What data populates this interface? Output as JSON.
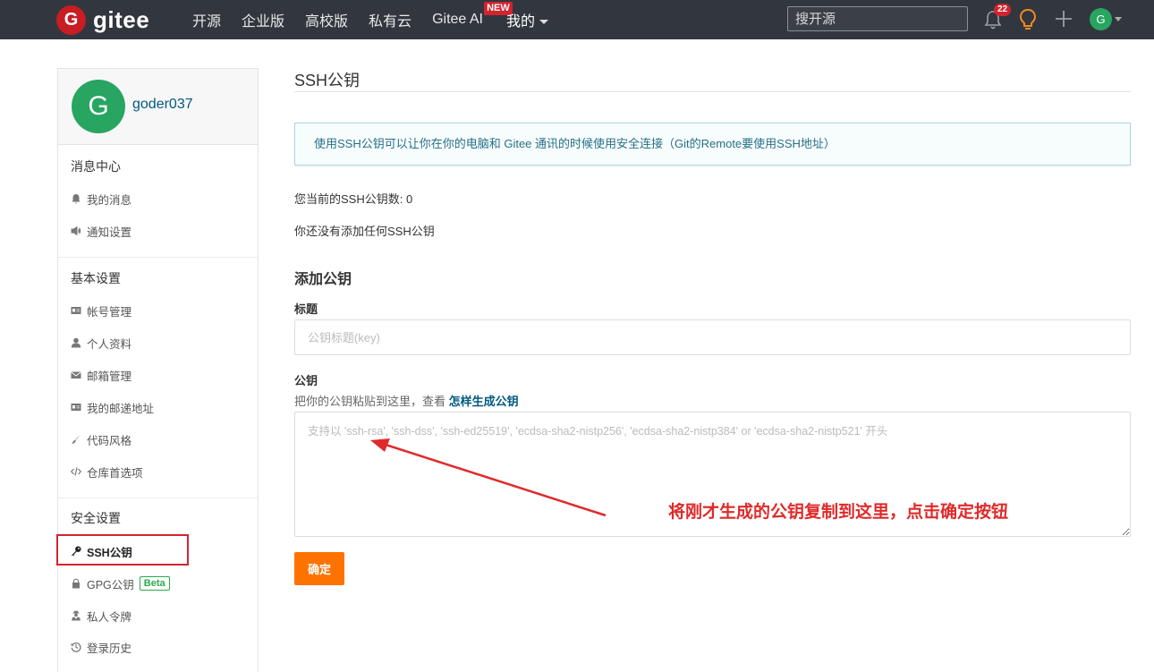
{
  "topbar": {
    "logo_letter": "G",
    "logo_text": "gitee",
    "nav": [
      {
        "label": "开源"
      },
      {
        "label": "企业版"
      },
      {
        "label": "高校版"
      },
      {
        "label": "私有云"
      },
      {
        "label": "Gitee AI",
        "badge": "NEW"
      },
      {
        "label": "我的"
      }
    ],
    "search_placeholder": "搜开源",
    "notification_count": "22",
    "avatar_letter": "G",
    "icons": [
      "bell-icon",
      "lightbulb-icon",
      "plus-icon",
      "chevron-down-icon"
    ]
  },
  "sidebar": {
    "profile": {
      "avatar_letter": "G",
      "username": "goder037"
    },
    "sections": [
      {
        "title": "消息中心",
        "items": [
          {
            "label": "我的消息",
            "icon": "bell-icon"
          },
          {
            "label": "通知设置",
            "icon": "volume-icon"
          }
        ]
      },
      {
        "title": "基本设置",
        "items": [
          {
            "label": "帐号管理",
            "icon": "id-card-icon"
          },
          {
            "label": "个人资料",
            "icon": "user-icon"
          },
          {
            "label": "邮箱管理",
            "icon": "envelope-icon"
          },
          {
            "label": "我的邮递地址",
            "icon": "id-card-icon"
          },
          {
            "label": "代码风格",
            "icon": "brush-icon"
          },
          {
            "label": "仓库首选项",
            "icon": "code-icon"
          }
        ]
      },
      {
        "title": "安全设置",
        "items": [
          {
            "label": "SSH公钥",
            "icon": "key-icon",
            "active": true
          },
          {
            "label": "GPG公钥",
            "icon": "lock-icon",
            "badge": "Beta"
          },
          {
            "label": "私人令牌",
            "icon": "user-secret-icon"
          },
          {
            "label": "登录历史",
            "icon": "history-icon"
          }
        ]
      }
    ]
  },
  "main": {
    "title": "SSH公钥",
    "info": "使用SSH公钥可以让你在你的电脑和 Gitee 通讯的时候使用安全连接（Git的Remote要使用SSH地址）",
    "count_text": "您当前的SSH公钥数: 0",
    "empty_text": "你还没有添加任何SSH公钥",
    "add_heading": "添加公钥",
    "title_label": "标题",
    "title_placeholder": "公钥标题(key)",
    "key_label": "公钥",
    "key_hint": "把你的公钥粘贴到这里，查看 ",
    "key_hint_link": "怎样生成公钥",
    "key_placeholder": "支持以 'ssh-rsa', 'ssh-dss', 'ssh-ed25519', 'ecdsa-sha2-nistp256', 'ecdsa-sha2-nistp384' or 'ecdsa-sha2-nistp521' 开头",
    "confirm_label": "确定"
  },
  "annotation": {
    "text": "将刚才生成的公钥复制到这里，点击确定按钮",
    "color": "#e02a2a"
  },
  "colors": {
    "topbar_bg": "#32363f",
    "brand_red": "#c71d23",
    "confirm_orange": "#fe7300",
    "link_blue": "#005980",
    "avatar_green": "#28a561"
  }
}
